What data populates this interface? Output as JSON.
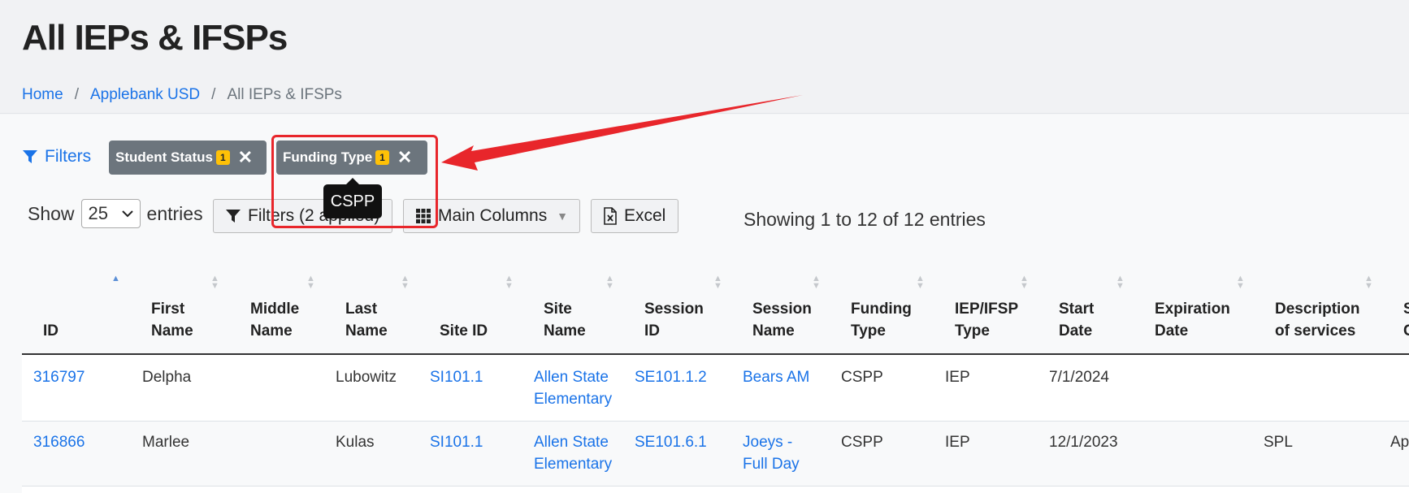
{
  "header": {
    "title": "All IEPs & IFSPs",
    "breadcrumb": [
      {
        "label": "Home",
        "link": true
      },
      {
        "label": "Applebank USD",
        "link": true
      },
      {
        "label": "All IEPs & IFSPs",
        "link": false
      }
    ],
    "separator": "/"
  },
  "filters": {
    "label": "Filters",
    "chips": [
      {
        "label": "Student Status",
        "count": "1",
        "remove": "✕"
      },
      {
        "label": "Funding Type",
        "count": "1",
        "remove": "✕"
      }
    ],
    "tooltip": "CSPP"
  },
  "toolbar": {
    "show_label": "Show",
    "entries_value": "25",
    "entries_label": "entries",
    "filters_button": "Filters (2 applied)",
    "columns_button": "Main Columns",
    "excel_button": "Excel",
    "showing_text": "Showing 1 to 12 of 12 entries"
  },
  "table": {
    "columns": [
      {
        "l1": "",
        "l2": "ID"
      },
      {
        "l1": "First",
        "l2": "Name"
      },
      {
        "l1": "Middle",
        "l2": "Name"
      },
      {
        "l1": "Last",
        "l2": "Name"
      },
      {
        "l1": "",
        "l2": "Site ID"
      },
      {
        "l1": "Site",
        "l2": "Name"
      },
      {
        "l1": "Session",
        "l2": "ID"
      },
      {
        "l1": "Session",
        "l2": "Name"
      },
      {
        "l1": "Funding",
        "l2": "Type"
      },
      {
        "l1": "IEP/IFSP",
        "l2": "Type"
      },
      {
        "l1": "Start",
        "l2": "Date"
      },
      {
        "l1": "Expiration",
        "l2": "Date"
      },
      {
        "l1": "Description",
        "l2": "of services"
      },
      {
        "l1": "S",
        "l2": "C"
      }
    ],
    "rows": [
      {
        "id": "316797",
        "first": "Delpha",
        "middle": "",
        "last": "Lubowitz",
        "site_id": "SI101.1",
        "site_name_1": "Allen State",
        "site_name_2": "Elementary",
        "session_id": "SE101.1.2",
        "session_name_1": "Bears AM",
        "session_name_2": "",
        "funding": "CSPP",
        "iep_type": "IEP",
        "start": "7/1/2024",
        "expiration": "",
        "description": "",
        "extra": ""
      },
      {
        "id": "316866",
        "first": "Marlee",
        "middle": "",
        "last": "Kulas",
        "site_id": "SI101.1",
        "site_name_1": "Allen State",
        "site_name_2": "Elementary",
        "session_id": "SE101.6.1",
        "session_name_1": "Joeys -",
        "session_name_2": "Full Day",
        "funding": "CSPP",
        "iep_type": "IEP",
        "start": "12/1/2023",
        "expiration": "",
        "description": "SPL",
        "extra": "Ap"
      }
    ]
  },
  "colors": {
    "link": "#1a73e8",
    "chip": "#6c757d",
    "badge": "#ffc107",
    "annotation": "#e8262b"
  }
}
